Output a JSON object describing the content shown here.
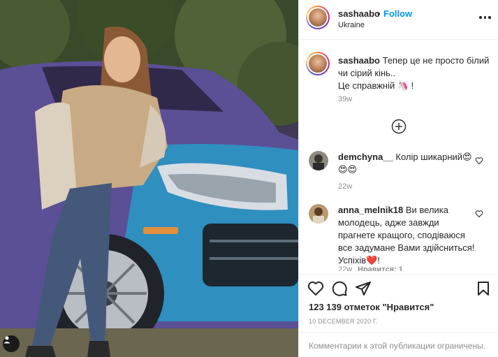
{
  "post": {
    "username": "sashaabo",
    "dot": "•",
    "follow_label": "Follow",
    "location": "Ukraine"
  },
  "caption": {
    "username": "sashaabo",
    "text_line1": "Тепер це не просто білий",
    "text_line2": "чи сірий кінь..",
    "text_line3": "Це справжній 🦄 !",
    "time": "39w"
  },
  "comments": [
    {
      "username": "demchyna__",
      "text_line1": "Колір шикарний😍",
      "text_line2": "😍😍",
      "time": "22w"
    },
    {
      "username": "anna_melnik18",
      "text_line1": "Ви велика",
      "text_line2": "молодець, адже завжди",
      "text_line3": "прагнете кращого, сподіваюся",
      "text_line4": "все задумане Вами здійсниться!",
      "text_line5": "Успіхів❤️!",
      "time": "22w",
      "replies": "Нравится: 1"
    }
  ],
  "stats": {
    "likes": "123 139 отметок \"Нравится\"",
    "date": "10 DECEMBER 2020 Г."
  },
  "restriction_text": "Комментарии к этой публикации ограничены.",
  "icons": {
    "more": "more-options-icon",
    "load": "load-more-comments-icon",
    "like": "heart-icon",
    "comment": "comment-icon",
    "share": "share-icon",
    "save": "bookmark-icon",
    "tagged": "user-tag-icon"
  },
  "colors": {
    "follow": "#0095f6",
    "muted": "#8e8e8e",
    "text": "#262626",
    "border": "#efefef"
  }
}
